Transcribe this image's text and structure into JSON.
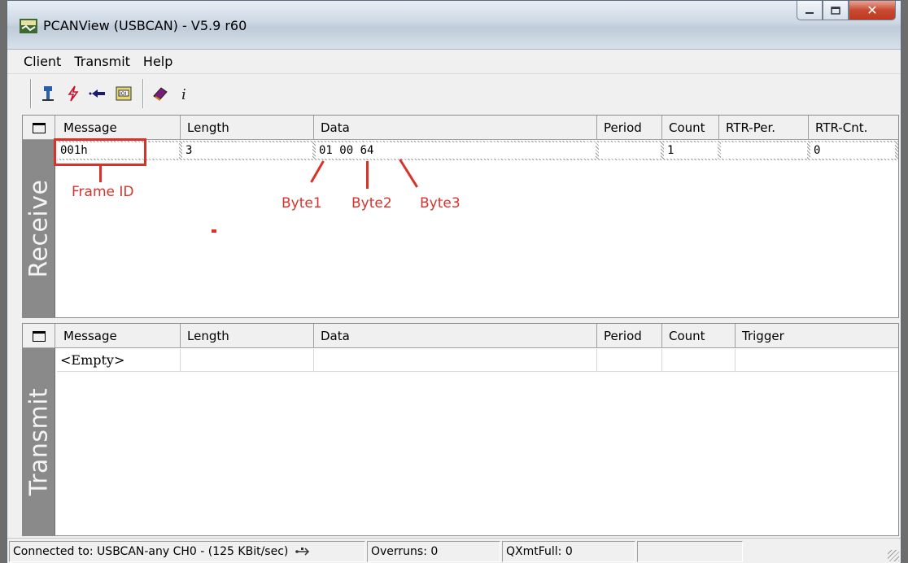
{
  "window": {
    "title": "PCANView (USBCAN) - V5.9 r60"
  },
  "menu": [
    "Client",
    "Transmit",
    "Help"
  ],
  "toolbar": {
    "icons": [
      "connect-icon",
      "lightning-icon",
      "arrow-left-icon",
      "bus-icon",
      "book-icon",
      "info-icon"
    ]
  },
  "receive": {
    "label": "Receive",
    "columns": [
      "Message",
      "Length",
      "Data",
      "Period",
      "Count",
      "RTR-Per.",
      "RTR-Cnt."
    ],
    "rows": [
      {
        "message": "001h",
        "length": "3",
        "data": "01 00 64",
        "period": "",
        "count": "1",
        "rtr_per": "",
        "rtr_cnt": "0"
      }
    ]
  },
  "transmit": {
    "label": "Transmit",
    "columns": [
      "Message",
      "Length",
      "Data",
      "Period",
      "Count",
      "Trigger"
    ],
    "empty_text": "<Empty>"
  },
  "annotations": {
    "frame_id": "Frame ID",
    "byte1": "Byte1",
    "byte2": "Byte2",
    "byte3": "Byte3",
    "color": "#d9322b"
  },
  "status": {
    "connection": "Connected to: USBCAN-any CH0 - (125 KBit/sec)",
    "overruns": "Overruns: 0",
    "qxmtfull": "QXmtFull: 0"
  }
}
